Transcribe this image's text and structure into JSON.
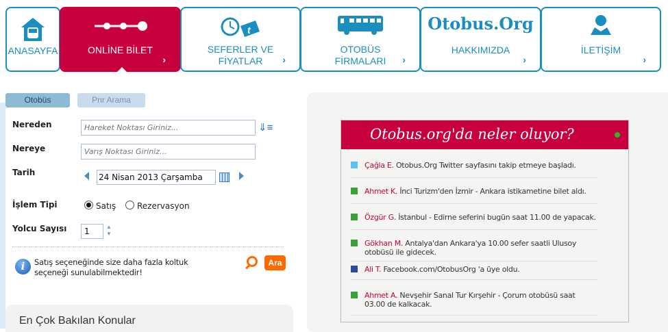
{
  "nav": [
    {
      "label": "ANASAYFA",
      "icon": "bus-garage-icon"
    },
    {
      "label": "ONLİNE BİLET",
      "icon": "route-steps-icon",
      "active": true
    },
    {
      "label": "SEFERLER VE FİYATLAR",
      "icon": "clock-ticket-icon"
    },
    {
      "label": "OTOBÜS FİRMALARI",
      "icon": "bus-icon"
    },
    {
      "label": "HAKKIMIZDA",
      "icon": "logo",
      "logo_text": "Otobus.Org"
    },
    {
      "label": "İLETİŞİM",
      "icon": "person-icon"
    }
  ],
  "tabs": {
    "bus": "Otobüs",
    "pnr": "Pnr Arama"
  },
  "form": {
    "from_label": "Nereden",
    "from_placeholder": "Hareket Noktası Giriniz...",
    "to_label": "Nereye",
    "to_placeholder": "Varış Noktası Giriniz...",
    "date_label": "Tarih",
    "date_value": "24 Nisan 2013 Çarşamba",
    "type_label": "İşlem Tipi",
    "type_sale": "Satış",
    "type_reservation": "Rezervasyon",
    "type_selected": "Satış",
    "pax_label": "Yolcu Sayısı",
    "pax_value": "1",
    "info": "Satış seçeneğinde size daha fazla koltuk seçeneği sunulabilmektedir!",
    "search_label": "Ara"
  },
  "popular_title": "En Çok Bakılan Konular",
  "feed": {
    "title": "Otobus.org'da neler oluyor?",
    "items": [
      {
        "icon": "twitter-icon",
        "name": "Çağla E.",
        "text": "Otobus.Org Twitter sayfasını takip etmeye başladı."
      },
      {
        "icon": "ticket-icon",
        "name": "Ahmet K.",
        "text": "İnci Turizm'den İzmir - Ankara istikametine bilet aldı."
      },
      {
        "icon": "ticket-icon",
        "name": "Özgür G.",
        "text": "İstanbul - Edirne seferini bugün saat 11.00 de yapacak."
      },
      {
        "icon": "ticket-icon",
        "name": "Gökhan M.",
        "text": "Antalya'dan Ankara'ya 10.00 sefer saatli Ulusoy otobüsü ile gidecek."
      },
      {
        "icon": "facebook-icon",
        "name": "Ali T.",
        "text": "Facebook.com/OtobusOrg 'a üye oldu."
      },
      {
        "icon": "ticket-icon",
        "name": "Ahmet A.",
        "text": "Nevşehir Sanal Tur Kırşehir - Çorum otobüsü saat 03.00 de kalkacak."
      }
    ]
  },
  "colors": {
    "brand": "#c8003e",
    "accent": "#1a8fbf",
    "search": "#ff6a00"
  }
}
